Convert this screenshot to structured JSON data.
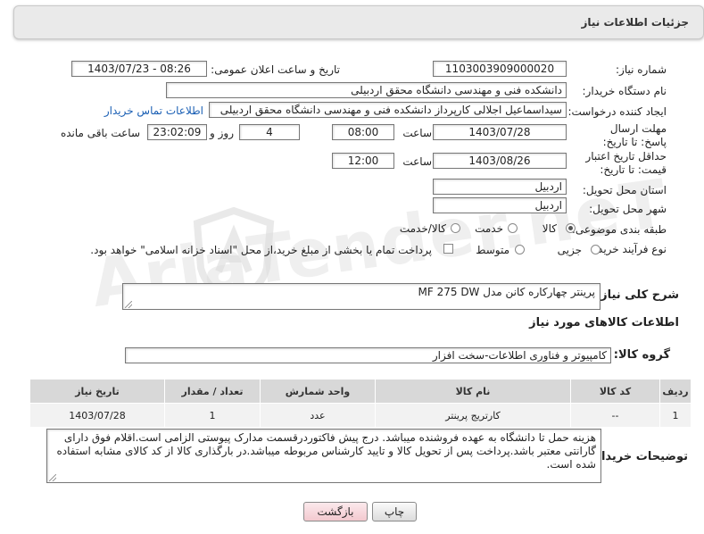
{
  "header": {
    "title": "جزئیات اطلاعات نیاز"
  },
  "fields": {
    "need_number_label": "شماره نیاز:",
    "need_number": "1103003909000020",
    "announce_label": "تاریخ و ساعت اعلان عمومی:",
    "announce_value": "1403/07/23 - 08:26",
    "buyer_org_label": "نام دستگاه خریدار:",
    "buyer_org": "دانشکده فنی و مهندسی دانشگاه محقق اردبیلی",
    "creator_label": "ایجاد کننده درخواست:",
    "creator": "سیداسماعیل اجلالی کارپرداز دانشکده فنی و مهندسی دانشگاه محقق اردبیلی",
    "contact_link": "اطلاعات تماس خریدار",
    "reply_deadline_label": "مهلت ارسال پاسخ: تا تاریخ:",
    "reply_date": "1403/07/28",
    "time_label": "ساعت",
    "reply_time": "08:00",
    "days_value": "4",
    "days_label": "روز و",
    "remaining_time": "23:02:09",
    "remaining_label": "ساعت باقی مانده",
    "validity_label": "حداقل تاریخ اعتبار قیمت: تا تاریخ:",
    "validity_date": "1403/08/26",
    "validity_time": "12:00",
    "province_label": "استان محل تحویل:",
    "province": "اردبیل",
    "city_label": "شهر محل تحویل:",
    "city": "اردبیل",
    "category_label": "طبقه بندی موضوعی:",
    "category_options": [
      "کالا",
      "خدمت",
      "کالا/خدمت"
    ],
    "process_label": "نوع فرآیند خرید :",
    "process_options": [
      "جزیی",
      "متوسط"
    ],
    "payment_note": "پرداخت تمام یا بخشی از مبلغ خرید،از محل \"اسناد خزانه اسلامی\" خواهد بود."
  },
  "summary": {
    "label": "شرح کلی نیاز:",
    "value": "پرینتر چهارکاره کانن مدل MF 275 DW"
  },
  "goods": {
    "section_title": "اطلاعات کالاهای مورد نیاز",
    "group_label": "گروه کالا:",
    "group_value": "کامپیوتر و فناوری اطلاعات-سخت افزار",
    "columns": [
      "ردیف",
      "کد کالا",
      "نام کالا",
      "واحد شمارش",
      "تعداد / مقدار",
      "تاریخ نیاز"
    ],
    "rows": [
      {
        "row": "1",
        "code": "--",
        "name": "کارتریج پرینتر",
        "unit": "عدد",
        "qty": "1",
        "date": "1403/07/28"
      }
    ]
  },
  "buyer_notes": {
    "label": "توضیحات خریدار:",
    "text": "هزینه حمل تا دانشگاه به عهده فروشنده میباشد. درج پیش فاکتوردرقسمت مدارک پیوستی الزامی است.اقلام فوق دارای گارانتی معتبر باشد.پرداخت پس از تحویل کالا و تایید کارشناس مربوطه میباشد.در بارگذاری کالا از کد کالای مشابه استفاده شده است."
  },
  "buttons": {
    "print": "چاپ",
    "back": "بازگشت"
  },
  "watermark": "AriaTender.neT"
}
